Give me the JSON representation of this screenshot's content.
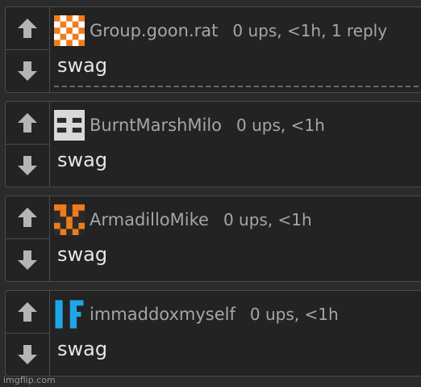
{
  "comments": [
    {
      "username": "Group.goon.rat",
      "meta": "0 ups, <1h, 1 reply",
      "body": "swag",
      "avatar_color": "#f07c1a",
      "avatar_icon": "checker-avatar-orange"
    },
    {
      "username": "BurntMarshMilo",
      "meta": "0 ups, <1h",
      "body": "swag",
      "avatar_color": "#d9d9d9",
      "avatar_icon": "blocky-avatar-gray"
    },
    {
      "username": "ArmadilloMike",
      "meta": "0 ups, <1h",
      "body": "swag",
      "avatar_color": "#f07c1a",
      "avatar_icon": "checker-avatar-orange-2"
    },
    {
      "username": "immaddoxmyself",
      "meta": "0 ups, <1h",
      "body": "swag",
      "avatar_color": "#20a6e8",
      "avatar_icon": "blocky-avatar-blue"
    }
  ],
  "watermark": "imgflip.com",
  "colors": {
    "background": "#2b2b2b",
    "card": "#232323",
    "border": "#4a4a4a",
    "arrow": "#b5b5b5"
  }
}
